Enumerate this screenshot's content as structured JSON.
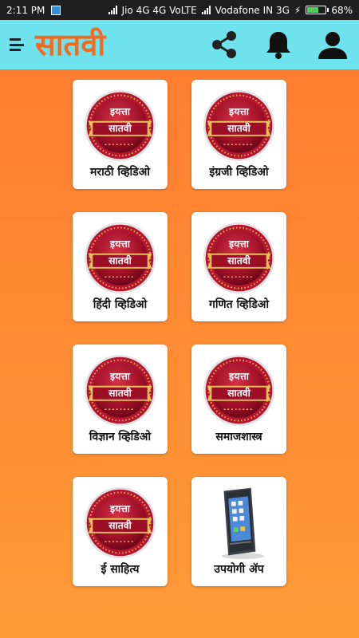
{
  "status_bar": {
    "time": "2:11 PM",
    "carrier1": "Jio 4G 4G VoLTE",
    "carrier2": "Vodafone IN 3G",
    "battery": "68%",
    "battery_level": 0.68
  },
  "app_bar": {
    "title": "सातवी",
    "icons": [
      "menu-icon",
      "share-icon",
      "bell-icon",
      "account-icon"
    ]
  },
  "logo": {
    "top_text": "इयत्ता",
    "bottom_text": "सातवी"
  },
  "tiles": [
    {
      "label": "मराठी व्हिडिओ",
      "icon": "badge-logo"
    },
    {
      "label": "इंग्रजी व्हिडिओ",
      "icon": "badge-logo"
    },
    {
      "label": "हिंदी व्हिडिओ",
      "icon": "badge-logo"
    },
    {
      "label": "गणित व्हिडिओ",
      "icon": "badge-logo"
    },
    {
      "label": "विज्ञान व्हिडिओ",
      "icon": "badge-logo"
    },
    {
      "label": "समाजशास्त्र",
      "icon": "badge-logo"
    },
    {
      "label": "ई साहित्य",
      "icon": "badge-logo"
    },
    {
      "label": "उपयोगी ॲप",
      "icon": "phone-icon"
    }
  ],
  "colors": {
    "app_bar": "#6fe3ed",
    "title": "#f36a1f",
    "background_top": "#ff7a2f",
    "background_bottom": "#ff9a36",
    "badge": "#a8122a",
    "badge_ring": "#e8c15a"
  }
}
